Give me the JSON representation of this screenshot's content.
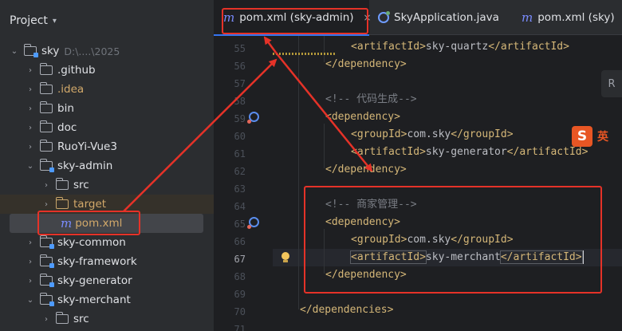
{
  "project_panel": {
    "title": "Project",
    "root": {
      "name": "sky",
      "path": "D:\\....\\2025"
    },
    "items": [
      {
        "label": ".github",
        "expanded": false
      },
      {
        "label": ".idea",
        "expanded": false
      },
      {
        "label": "bin",
        "expanded": false
      },
      {
        "label": "doc",
        "expanded": false
      },
      {
        "label": "RuoYi-Vue3",
        "expanded": false
      },
      {
        "label": "sky-admin",
        "expanded": true
      },
      {
        "label": "src",
        "expanded": false
      },
      {
        "label": "target",
        "expanded": false
      },
      {
        "label": "pom.xml",
        "selected": true
      },
      {
        "label": "sky-common",
        "expanded": false
      },
      {
        "label": "sky-framework",
        "expanded": false
      },
      {
        "label": "sky-generator",
        "expanded": false
      },
      {
        "label": "sky-merchant",
        "expanded": true
      },
      {
        "label": "src",
        "expanded": false
      }
    ]
  },
  "tabs": [
    {
      "label": "pom.xml (sky-admin)",
      "active": true
    },
    {
      "label": "SkyApplication.java",
      "active": false
    },
    {
      "label": "pom.xml (sky)",
      "active": false
    }
  ],
  "tab_close_glyph": "×",
  "editor": {
    "line_numbers": [
      "55",
      "56",
      "57",
      "58",
      "59",
      "60",
      "61",
      "62",
      "63",
      "64",
      "65",
      "66",
      "67",
      "68",
      "69",
      "70",
      "71"
    ],
    "current_line": "67",
    "lines": {
      "l55_open": "<artifactId>",
      "l55_val": "sky-quartz",
      "l55_close": "</artifactId>",
      "l56": "</dependency>",
      "l58": "<!-- 代码生成-->",
      "l59": "<dependency>",
      "l60_open": "<groupId>",
      "l60_val": "com.sky",
      "l60_close": "</groupId>",
      "l61_open": "<artifactId>",
      "l61_val": "sky-generator",
      "l61_close": "</artifactId>",
      "l62": "</dependency>",
      "l64": "<!-- 商家管理-->",
      "l65": "<dependency>",
      "l66_open": "<groupId>",
      "l66_val": "com.sky",
      "l66_close": "</groupId>",
      "l67_open": "<artifactId>",
      "l67_val": "sky-merchant",
      "l67_close": "</artifactId>",
      "l68": "</dependency>",
      "l70": "</dependencies>"
    }
  },
  "ime": {
    "logo": "S",
    "mode": "英"
  },
  "float_button": "R",
  "colors": {
    "annotation": "#e53228",
    "accent": "#3574f0",
    "tag": "#d5b778"
  }
}
